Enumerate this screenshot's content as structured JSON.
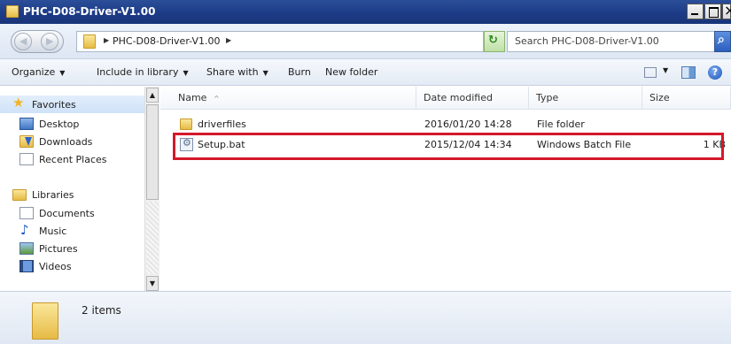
{
  "window": {
    "title": "PHC-D08-Driver-V1.00"
  },
  "address": {
    "crumb": "PHC-D08-Driver-V1.00",
    "search_placeholder": "Search PHC-D08-Driver-V1.00"
  },
  "toolbar": {
    "organize": "Organize",
    "include_in_library": "Include in library",
    "share_with": "Share with",
    "burn": "Burn",
    "new_folder": "New folder"
  },
  "sidebar": {
    "favorites": "Favorites",
    "favorite_items": [
      "Desktop",
      "Downloads",
      "Recent Places"
    ],
    "libraries": "Libraries",
    "library_items": [
      "Documents",
      "Music",
      "Pictures",
      "Videos"
    ]
  },
  "columns": {
    "name": "Name",
    "date_modified": "Date modified",
    "type": "Type",
    "size": "Size"
  },
  "files": [
    {
      "name": "driverfiles",
      "date": "2016/01/20 14:28",
      "type": "File folder",
      "size": ""
    },
    {
      "name": "Setup.bat",
      "date": "2015/12/04 14:34",
      "type": "Windows Batch File",
      "size": "1 KB"
    }
  ],
  "status": {
    "item_count": "2 items"
  },
  "colors": {
    "title_bar": "#1d3b86",
    "highlight": "#d5192b",
    "selection": "#cfe2f8"
  }
}
